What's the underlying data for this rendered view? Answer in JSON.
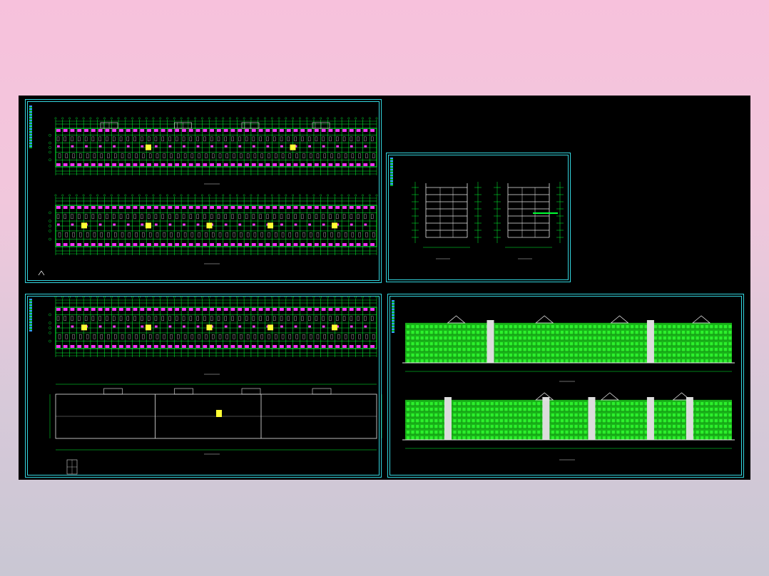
{
  "canvas": {
    "background": "#000000"
  },
  "colors": {
    "frame": "#33d6df",
    "grid": "#00ff33",
    "wall": "#ff33ff",
    "accent": "#ffff33",
    "text": "#e8e8e8"
  },
  "sheets": {
    "top_left": {
      "titleblock": "",
      "drawing": "floor-plans"
    },
    "top_right": {
      "titleblock": "",
      "drawing": "sections"
    },
    "bottom_left": {
      "titleblock": "",
      "drawing": "floor-and-roof-plans"
    },
    "bottom_right": {
      "titleblock": "",
      "drawing": "elevations"
    }
  }
}
